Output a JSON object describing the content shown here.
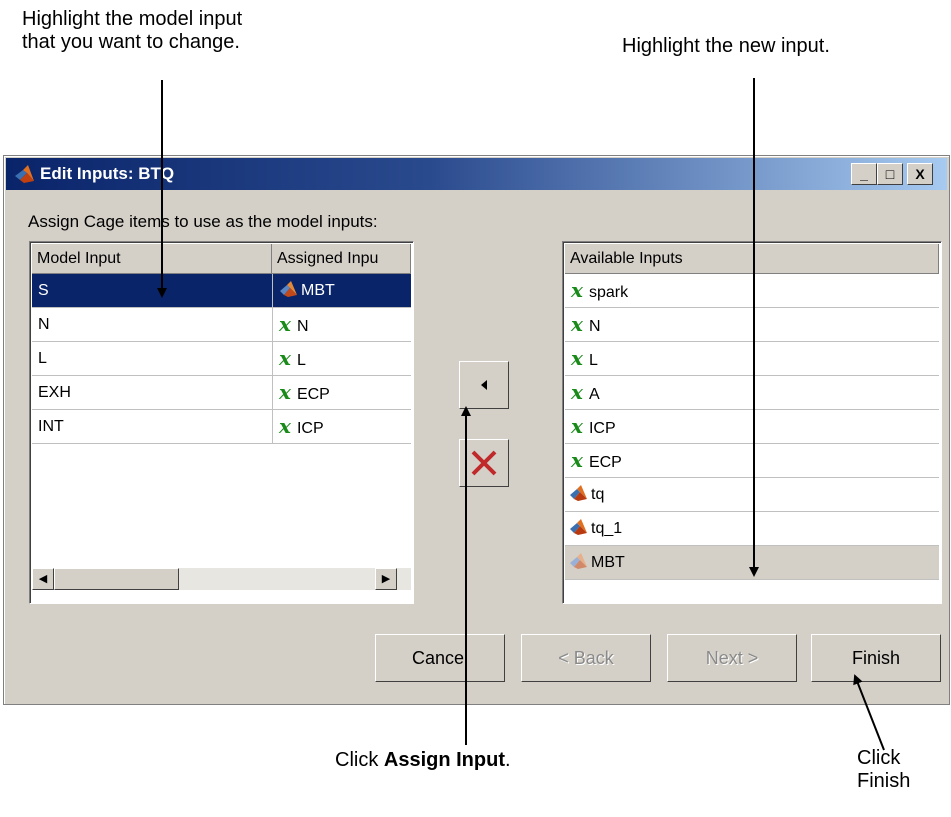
{
  "annotations": {
    "top_left_line1": "Highlight the model input",
    "top_left_line2": "that you want to change.",
    "top_right": "Highlight the new input.",
    "assign_prefix": "Click ",
    "assign_bold": "Assign Input",
    "assign_suffix": ".",
    "finish_line1": "Click",
    "finish_line2": "Finish"
  },
  "window": {
    "title": "Edit Inputs: BTQ",
    "minimize_label": "_",
    "maximize_label": "□",
    "close_label": "X"
  },
  "prompt": "Assign Cage items to use as the model inputs:",
  "left_table": {
    "headers": [
      "Model Input",
      "Assigned Inpu"
    ],
    "rows": [
      {
        "model": "S",
        "assigned": "MBT",
        "icon": "cage-model-icon",
        "selected": true
      },
      {
        "model": "N",
        "assigned": "N",
        "icon": "variable-x-icon"
      },
      {
        "model": "L",
        "assigned": "L",
        "icon": "variable-x-icon"
      },
      {
        "model": "EXH",
        "assigned": "ECP",
        "icon": "variable-x-icon"
      },
      {
        "model": "INT",
        "assigned": "ICP",
        "icon": "variable-x-icon"
      }
    ]
  },
  "right_list": {
    "header": "Available Inputs",
    "items": [
      {
        "label": "spark",
        "icon": "variable-x-icon"
      },
      {
        "label": "N",
        "icon": "variable-x-icon"
      },
      {
        "label": "L",
        "icon": "variable-x-icon"
      },
      {
        "label": "A",
        "icon": "variable-x-icon"
      },
      {
        "label": "ICP",
        "icon": "variable-x-icon"
      },
      {
        "label": "ECP",
        "icon": "variable-x-icon"
      },
      {
        "label": "tq",
        "icon": "cage-model-icon"
      },
      {
        "label": "tq_1",
        "icon": "cage-model-icon"
      },
      {
        "label": "MBT",
        "icon": "cage-model-icon",
        "highlighted": true
      }
    ]
  },
  "icons": {
    "variable_glyph": "x",
    "assign_icon": "left-triangle-icon",
    "remove_icon": "red-x-icon"
  },
  "scroll": {
    "left_arrow": "◀",
    "right_arrow": "▶"
  },
  "buttons": {
    "cancel": "Cancel",
    "back": "< Back",
    "next": "Next >",
    "finish": "Finish"
  },
  "colors": {
    "title_bar_start": "#0a246a",
    "title_bar_end": "#a6caf0",
    "selection": "#0a246a",
    "variable_icon": "#1a8a1a",
    "remove_icon": "#c0282a",
    "dialog_face": "#d4d0c8"
  }
}
